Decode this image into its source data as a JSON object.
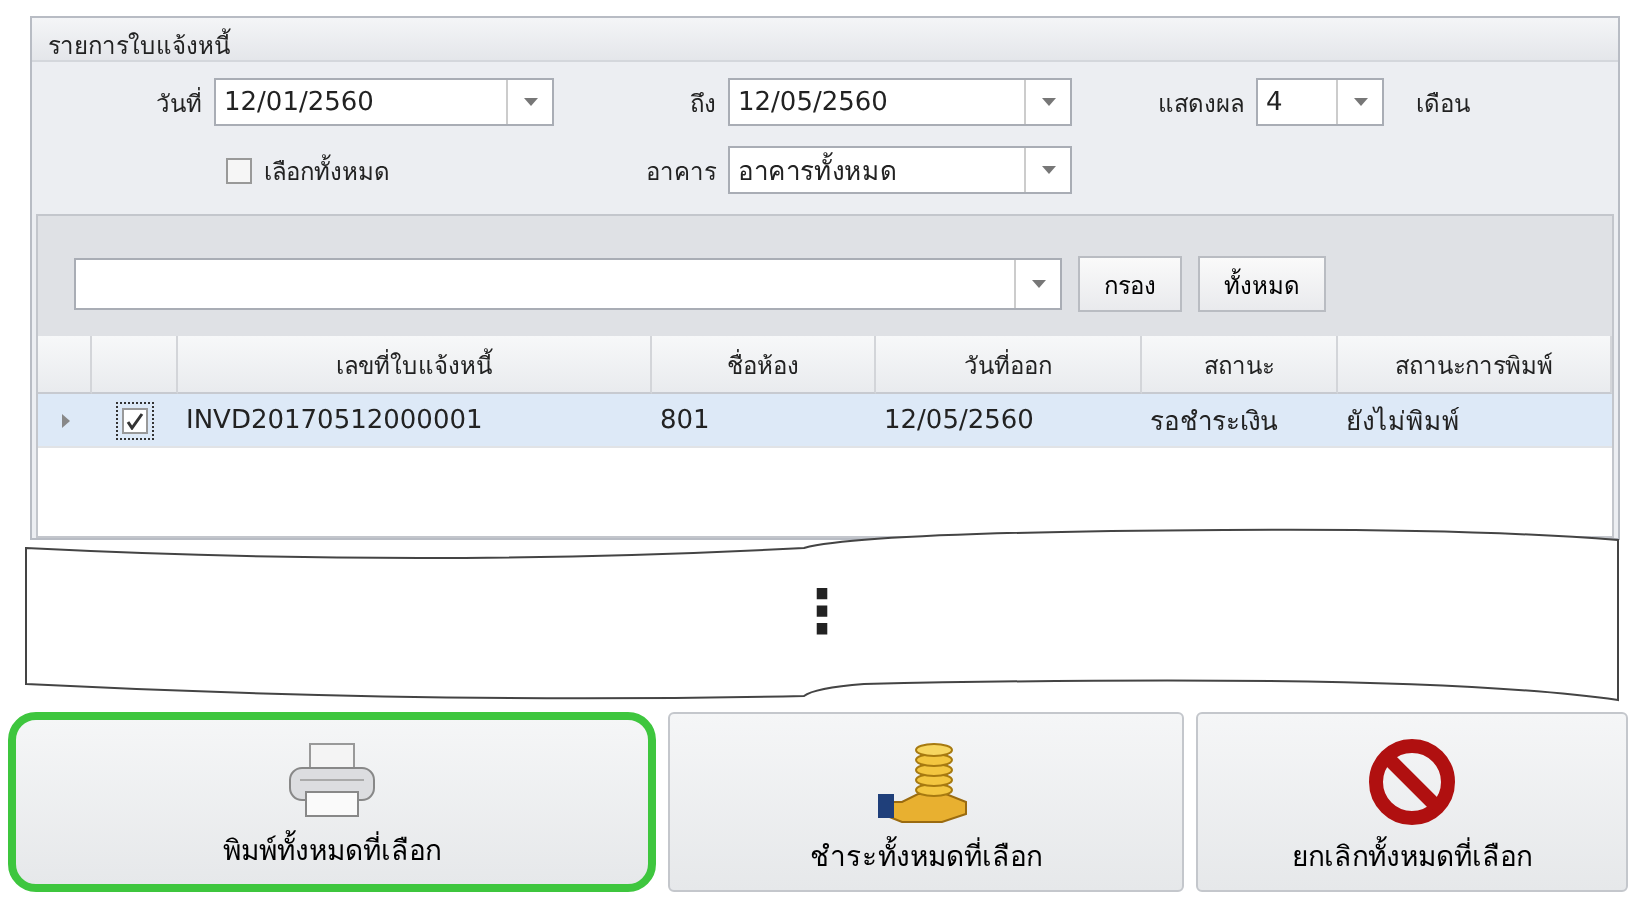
{
  "panel": {
    "title": "รายการใบแจ้งหนี้"
  },
  "filters": {
    "date_label": "วันที่",
    "date_from": "12/01/2560",
    "to_label": "ถึง",
    "date_to": "12/05/2560",
    "show_label": "แสดงผล",
    "months": "4",
    "months_unit": "เดือน",
    "select_all": {
      "label": "เลือกทั้งหมด",
      "checked": false
    },
    "building_label": "อาคาร",
    "building": "อาคารทั้งหมด"
  },
  "search": {
    "filter_button": "กรอง",
    "all_button": "ทั้งหมด"
  },
  "table": {
    "columns": [
      "เลขที่ใบแจ้งหนี้",
      "ชื่อห้อง",
      "วันที่ออก",
      "สถานะ",
      "สถานะการพิมพ์"
    ],
    "rows": [
      {
        "checked": true,
        "selected": true,
        "cells": [
          "INVD20170512000001",
          "801",
          "12/05/2560",
          "รอชำระเงิน",
          "ยังไม่พิมพ์"
        ]
      }
    ]
  },
  "break": {
    "mark": "⋮"
  },
  "actions": [
    {
      "label": "พิมพ์ทั้งหมดที่เลือก",
      "kind": "print",
      "highlighted": true
    },
    {
      "label": "ชำระทั้งหมดที่เลือก",
      "kind": "pay",
      "highlighted": false
    },
    {
      "label": "ยกเลิกทั้งหมดที่เลือก",
      "kind": "cancel",
      "highlighted": false
    }
  ]
}
